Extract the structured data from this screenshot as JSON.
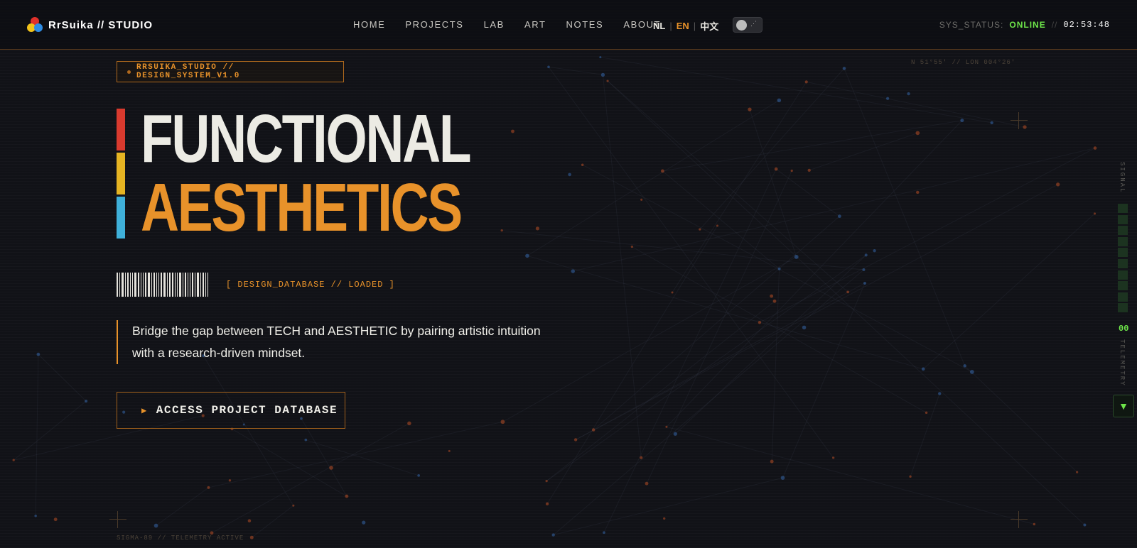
{
  "header": {
    "logo_text": "RrSuika // STUDIO",
    "nav": [
      "HOME",
      "PROJECTS",
      "LAB",
      "ART",
      "NOTES",
      "ABOUT"
    ],
    "languages": [
      "NL",
      "EN",
      "中文"
    ],
    "active_language": "EN",
    "status_label": "SYS_STATUS:",
    "status_value": "ONLINE",
    "status_separator": "//",
    "time": "02:53:48"
  },
  "coords": "N 51°55' // LON 004°26'",
  "hero": {
    "badge": "RRSUIKA_STUDIO // DESIGN_SYSTEM_V1.0",
    "title_line1": "FUNCTIONAL",
    "title_line2": "AESTHETICS",
    "db_status": "[ DESIGN_DATABASE // LOADED ]",
    "description": "Bridge the gap between TECH and AESTHETIC by pairing artistic intuition with a research-driven mindset.",
    "cta_label": "ACCESS PROJECT DATABASE"
  },
  "footer_label": "SIGMA-89 // TELEMETRY ACTIVE",
  "rail": {
    "signal_label": "SIGNAL",
    "readout": "00",
    "telemetry_label": "TELEMETRY"
  },
  "colors": {
    "accent": "#e8922a",
    "online": "#6ee64a",
    "bar_red": "#d93a2e",
    "bar_yellow": "#e6b422",
    "bar_blue": "#3fb0d9"
  },
  "icons": {
    "logo": "rgb-circles-logo",
    "theme_toggle": "moon-stars-icon",
    "cta": "play-triangle-icon",
    "scroll": "chevron-down-icon"
  }
}
